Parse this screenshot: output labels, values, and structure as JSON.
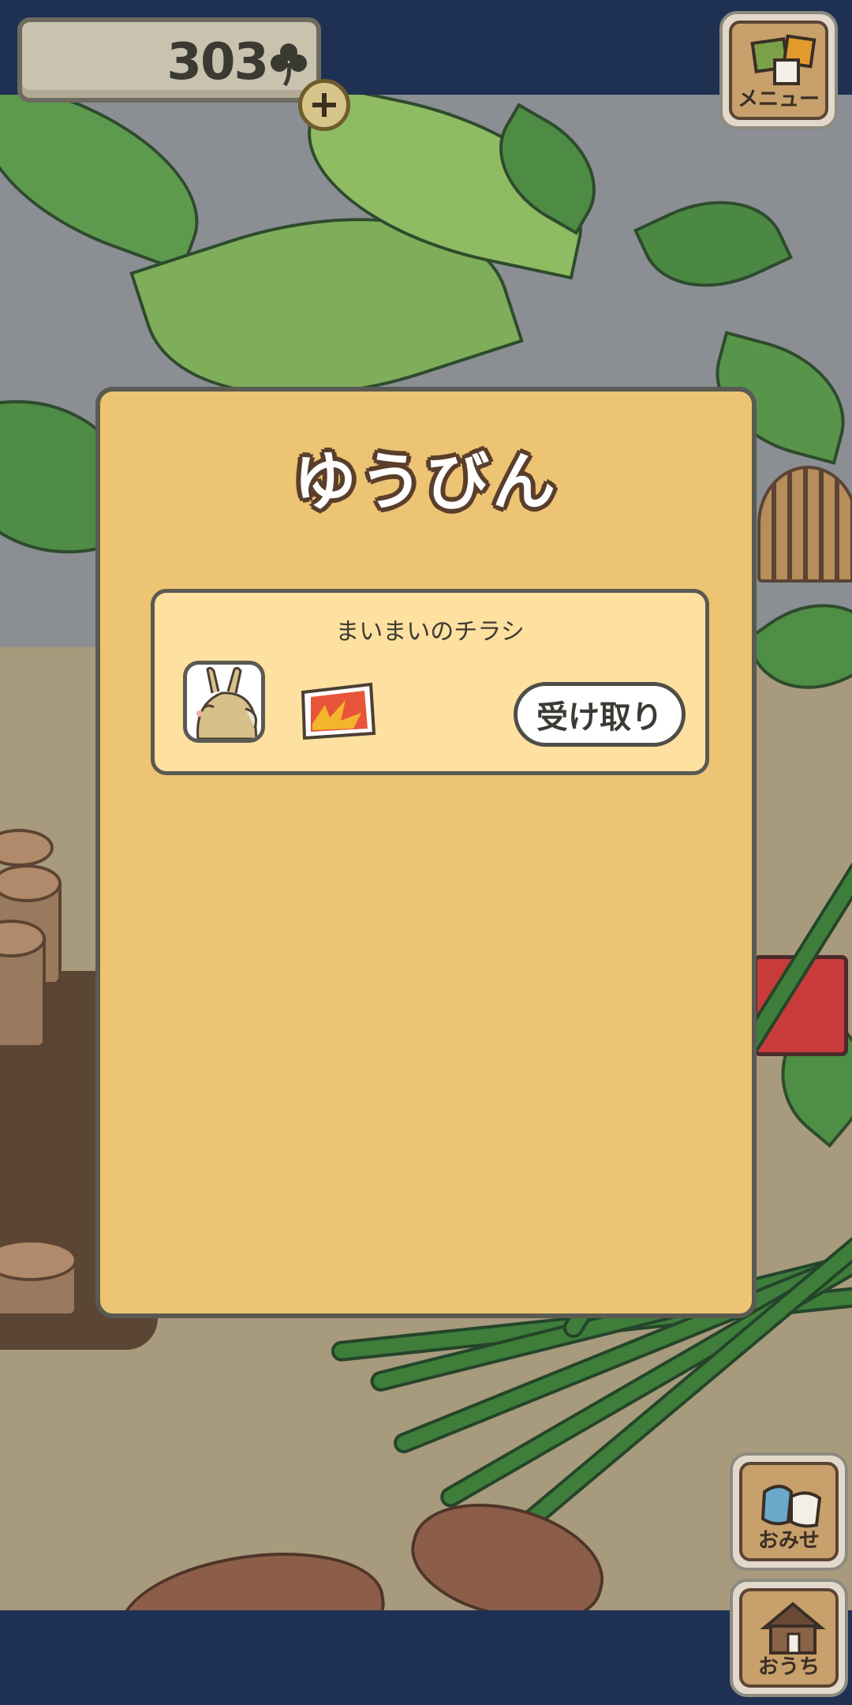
{
  "hud": {
    "clover_count": "303",
    "menu_label": "メニュー",
    "shop_label": "おみせ",
    "home_label": "おうち"
  },
  "dialog": {
    "title": "ゆうびん",
    "items": [
      {
        "title": "まいまいのチラシ",
        "sender_icon": "snail-character-avatar",
        "attachment_icon": "flyer-icon",
        "receive_label": "受け取り"
      }
    ]
  },
  "colors": {
    "top_bar": "#1f3153",
    "dialog_bg": "#ecc473",
    "mail_item_bg": "#fee0a1",
    "title_outline": "#5a3e2b"
  }
}
